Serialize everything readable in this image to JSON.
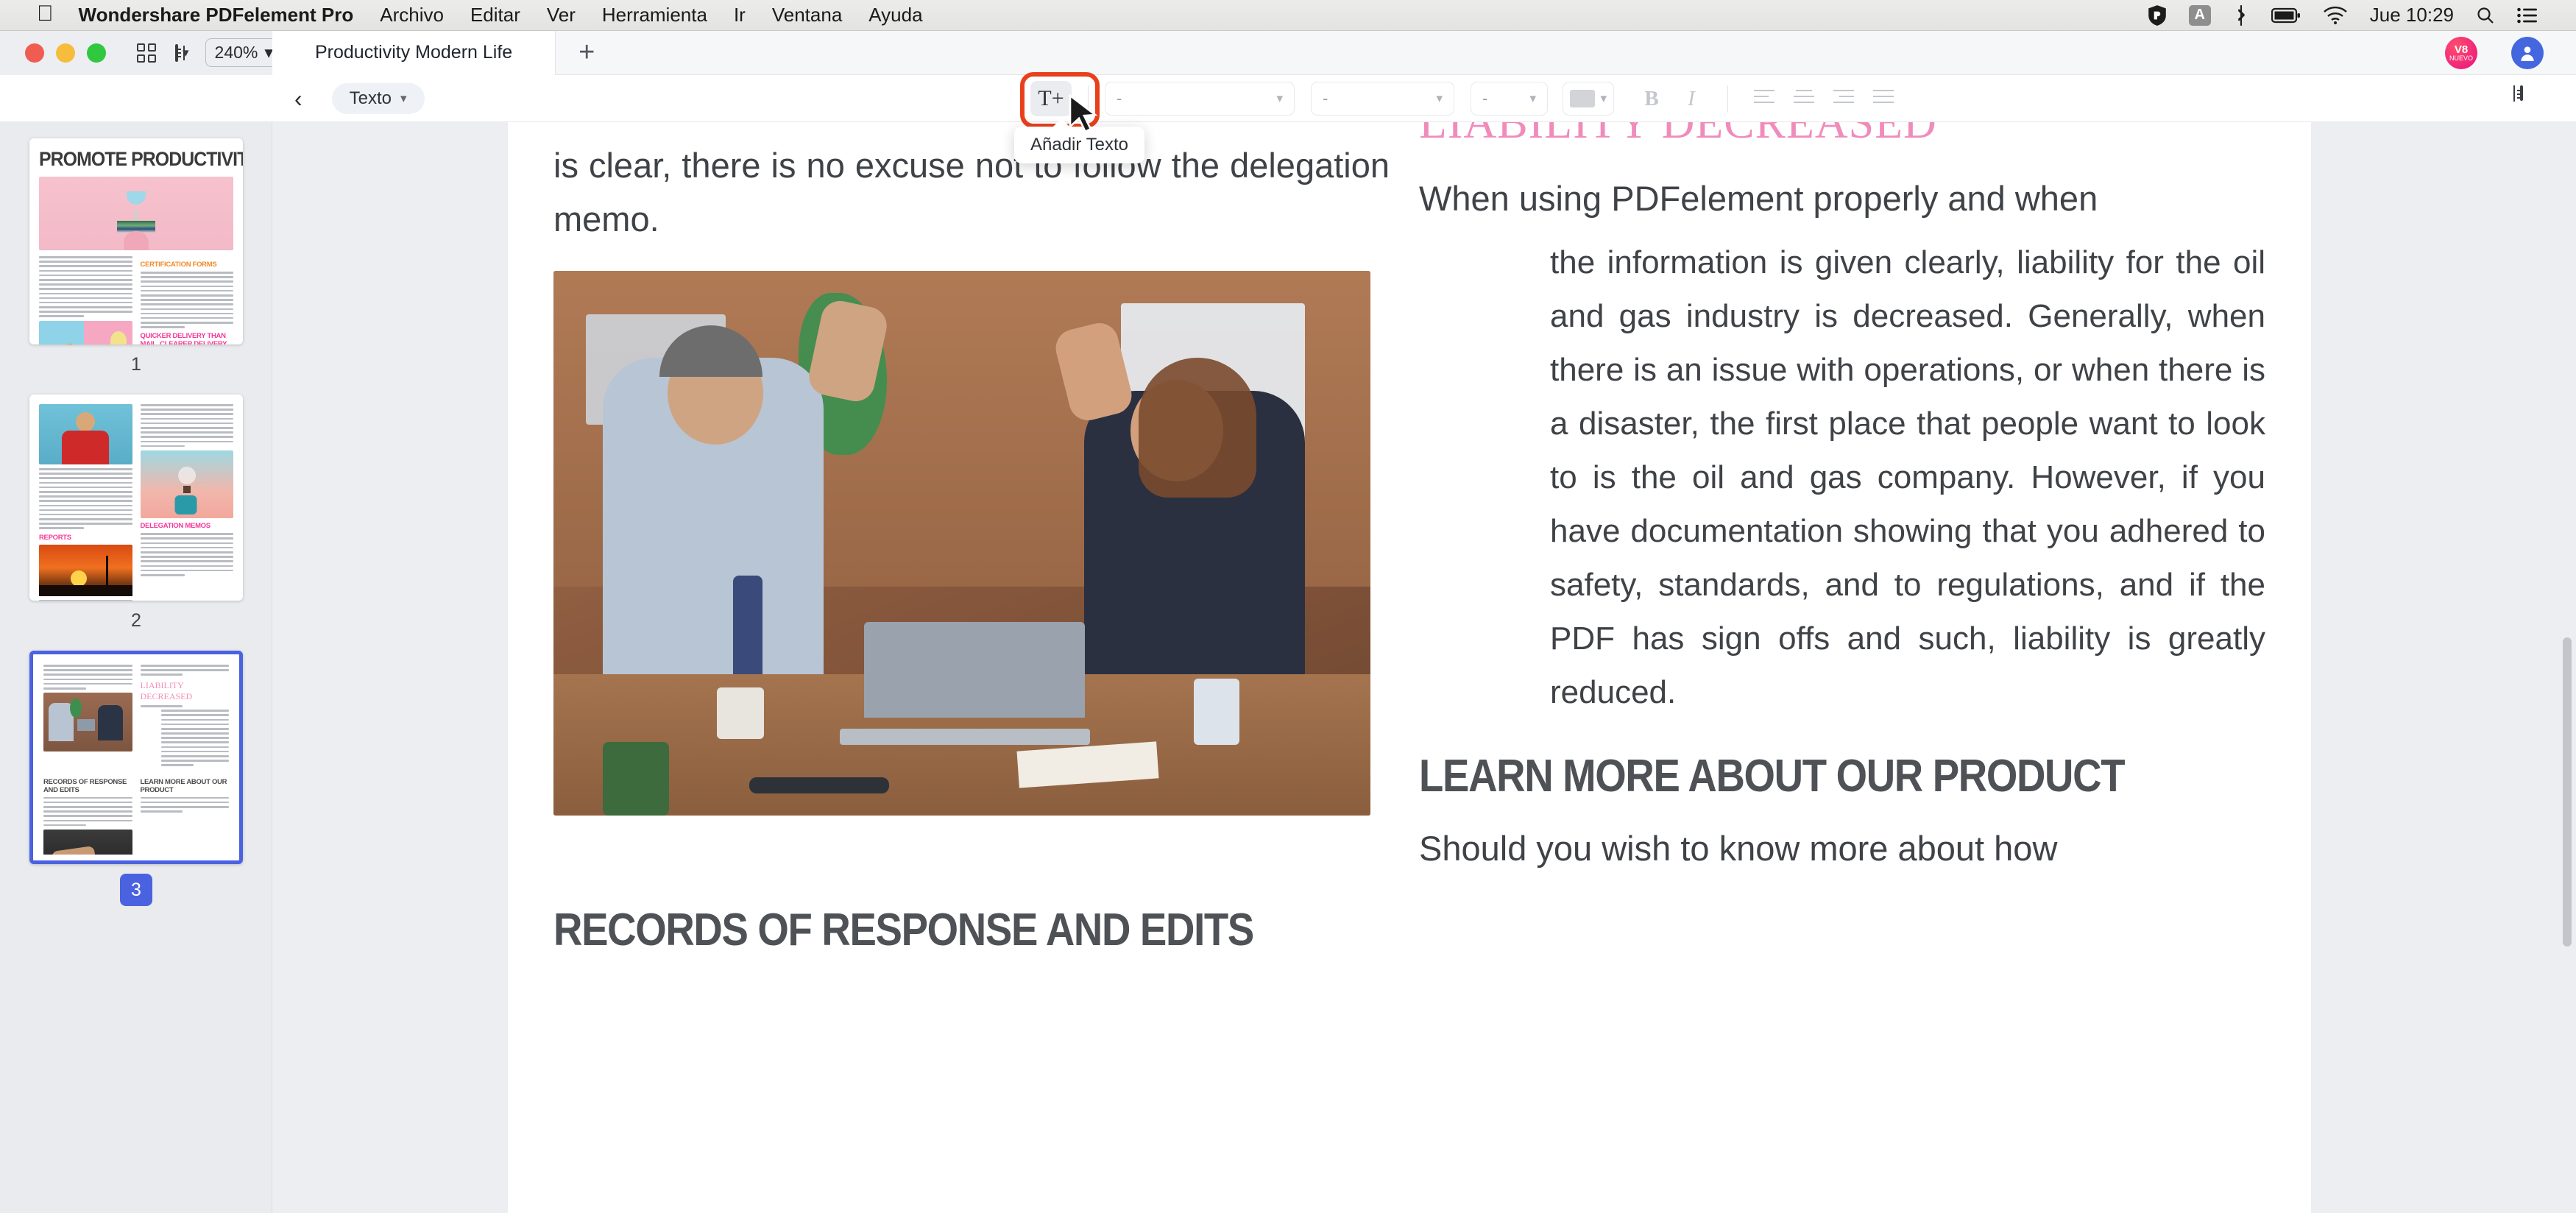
{
  "menubar": {
    "apple": "apple-logo",
    "app_name": "Wondershare PDFelement Pro",
    "items": [
      "Archivo",
      "Editar",
      "Ver",
      "Herramienta",
      "Ir",
      "Ventana",
      "Ayuda"
    ],
    "clock": "Jue 10:29",
    "status_icons": [
      "shield-icon",
      "keyboard-input-icon",
      "bluetooth-icon",
      "battery-icon",
      "wifi-icon",
      "search-icon",
      "control-center-icon"
    ]
  },
  "titlebar": {
    "zoom_level": "240%",
    "tab_title": "Productivity Modern Life",
    "new_tab_label": "+",
    "badge": {
      "line1": "V8",
      "line2": "NUEVO"
    }
  },
  "toolbar": {
    "back_label": "‹",
    "mode_label": "Texto",
    "add_text_glyph": "T+",
    "tooltip": "Añadir Texto",
    "font_family_value": "-",
    "font_size_value": "-",
    "font_style_value": "-",
    "bold_label": "B",
    "italic_label": "I",
    "color_swatch": "#d2d4d7",
    "highlight_color": "#e8401c"
  },
  "sidebar": {
    "pages": [
      {
        "number": "1",
        "selected": false,
        "title": "PROMOTE PRODUCTIVITY",
        "headings": [
          "CERTIFICATION FORMS",
          "QUICKER DELIVERY THAN MAIL, CLEARER DELIVERY THAN EMAIL"
        ]
      },
      {
        "number": "2",
        "selected": false,
        "title": "",
        "headings": [
          "REPORTS",
          "DELEGATION MEMOS"
        ]
      },
      {
        "number": "3",
        "selected": true,
        "title": "",
        "headings": [
          "LIABILITY DECREASED",
          "RECORDS OF RESPONSE AND EDITS",
          "LEARN MORE ABOUT OUR PRODUCT"
        ]
      }
    ]
  },
  "document": {
    "left_column": {
      "paragraph_top": "is clear, there is no excuse not to follow the delegation memo.",
      "heading_bottom": "RECORDS OF RESPONSE AND EDITS"
    },
    "right_column": {
      "heading_top": "LIABILITY DECREASED",
      "intro": "When using PDFelement properly and when",
      "body": "the information is given clearly, liability for the oil and gas industry is decreased. Generally, when there is an issue with operations, or when there is a disaster, the first place that people want to look to is the oil and gas company. However, if you have documentation showing that you adhered to safety, standards, and to regulations, and if the PDF has sign offs and such, liability is greatly reduced.",
      "heading_bottom": "LEARN MORE ABOUT OUR PRODUCT",
      "paragraph_bottom": "Should you wish to know more about how"
    }
  },
  "colors": {
    "accent_pink": "#f08cba",
    "heading_grey": "#4e5155",
    "select_blue": "#4b62e0",
    "annotation_red": "#e8401c"
  }
}
